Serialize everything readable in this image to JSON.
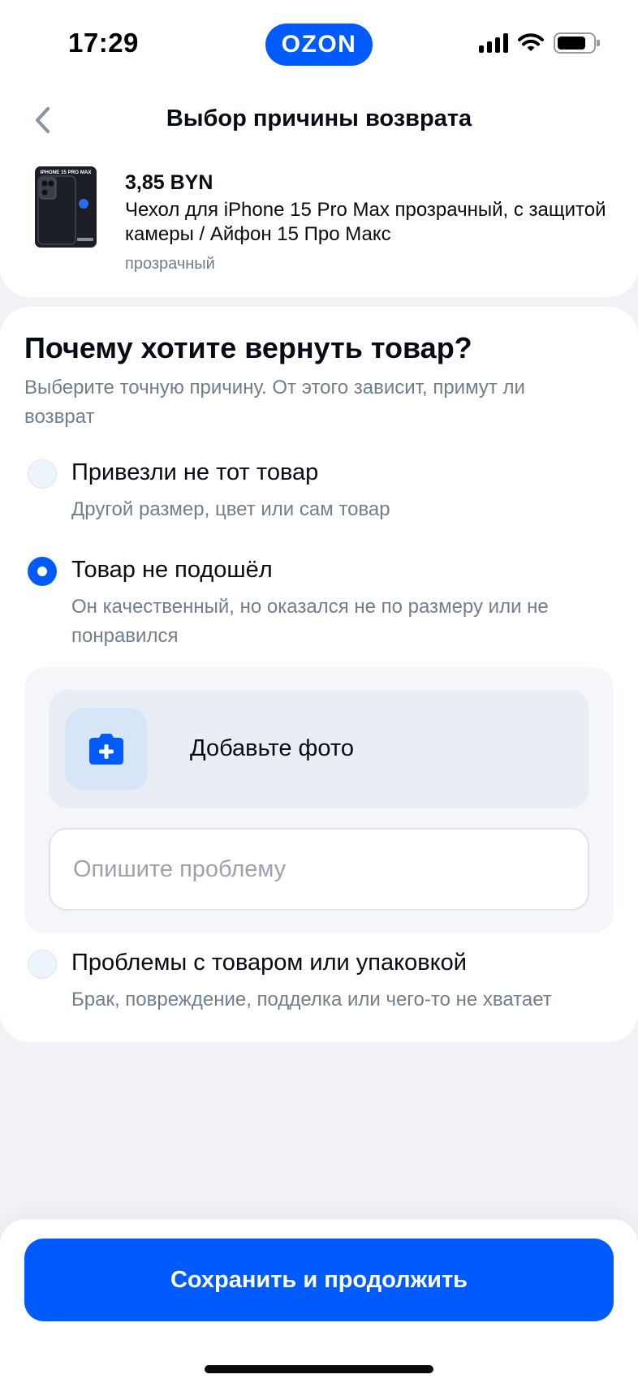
{
  "status_bar": {
    "time": "17:29",
    "app_logo": "OZON"
  },
  "header": {
    "title": "Выбор причины возврата",
    "back_icon": "chevron-left-icon"
  },
  "product": {
    "price": "3,85 BYN",
    "name": "Чехол для iPhone 15 Pro Max прозрачный, с защитой камеры / Айфон 15 Про Макс",
    "variant": "прозрачный",
    "image_caption": "IPHONE 15 PRO MAX"
  },
  "reason": {
    "title": "Почему хотите вернуть товар?",
    "subtitle": "Выберите точную причину. От этого зависит, примут ли возврат",
    "options": [
      {
        "title": "Привезли не тот товар",
        "description": "Другой размер, цвет или сам товар",
        "selected": false
      },
      {
        "title": "Товар не подошёл",
        "description": "Он качественный, но оказался не по размеру или не понравился",
        "selected": true
      },
      {
        "title": "Проблемы с товаром или упаковкой",
        "description": "Брак, повреждение, подделка или чего-то не хватает",
        "selected": false
      }
    ],
    "add_photo_label": "Добавьте фото",
    "add_photo_icon": "camera-plus-icon",
    "problem_input": {
      "value": "",
      "placeholder": "Опишите проблему"
    }
  },
  "footer": {
    "save_label": "Сохранить и продолжить"
  },
  "colors": {
    "brand": "#005bff",
    "text": "#070b13",
    "secondary_text": "#707f8d",
    "background": "#f1f2f6"
  }
}
